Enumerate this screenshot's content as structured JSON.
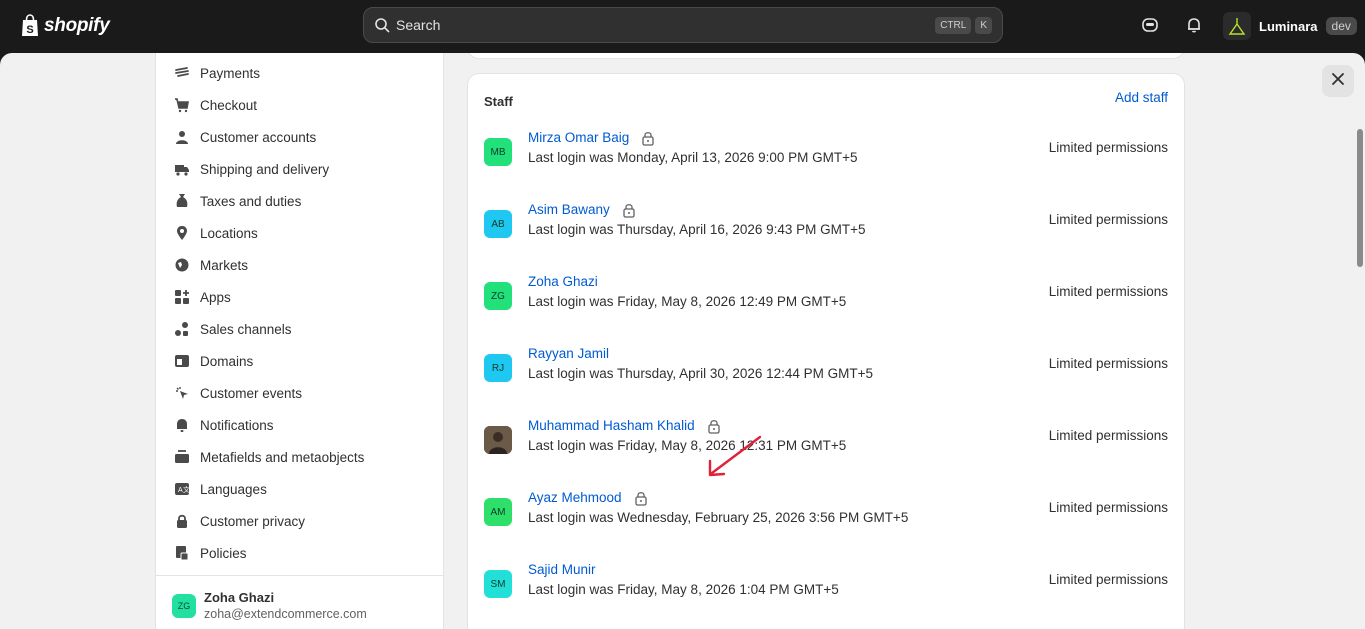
{
  "topbar": {
    "logo_text": "shopify",
    "search_placeholder": "Search",
    "kbd_ctrl": "CTRL",
    "kbd_k": "K",
    "store_name": "Luminara",
    "store_badge": "dev"
  },
  "sidebar": {
    "items": [
      {
        "label": "Payments",
        "icon": "payments-icon"
      },
      {
        "label": "Checkout",
        "icon": "cart-icon"
      },
      {
        "label": "Customer accounts",
        "icon": "person-icon"
      },
      {
        "label": "Shipping and delivery",
        "icon": "truck-icon"
      },
      {
        "label": "Taxes and duties",
        "icon": "tax-icon"
      },
      {
        "label": "Locations",
        "icon": "location-icon"
      },
      {
        "label": "Markets",
        "icon": "globe-icon"
      },
      {
        "label": "Apps",
        "icon": "apps-icon"
      },
      {
        "label": "Sales channels",
        "icon": "channels-icon"
      },
      {
        "label": "Domains",
        "icon": "domain-icon"
      },
      {
        "label": "Customer events",
        "icon": "cursor-icon"
      },
      {
        "label": "Notifications",
        "icon": "bell-icon"
      },
      {
        "label": "Metafields and metaobjects",
        "icon": "metafields-icon"
      },
      {
        "label": "Languages",
        "icon": "language-icon"
      },
      {
        "label": "Customer privacy",
        "icon": "lock-icon"
      },
      {
        "label": "Policies",
        "icon": "policy-icon"
      }
    ],
    "user": {
      "initials": "ZG",
      "name": "Zoha Ghazi",
      "email": "zoha@extendcommerce.com"
    }
  },
  "staff": {
    "title": "Staff",
    "add_label": "Add staff",
    "members": [
      {
        "initials": "MB",
        "name": "Mirza Omar Baig",
        "login": "Last login was Monday, April 13, 2026 9:00 PM GMT+5",
        "permission": "Limited permissions",
        "avatar_color": "#22e07a",
        "locked": true
      },
      {
        "initials": "AB",
        "name": "Asim Bawany",
        "login": "Last login was Thursday, April 16, 2026 9:43 PM GMT+5",
        "permission": "Limited permissions",
        "avatar_color": "#1fc8f0",
        "locked": true
      },
      {
        "initials": "ZG",
        "name": "Zoha Ghazi",
        "login": "Last login was Friday, May 8, 2026 12:49 PM GMT+5",
        "permission": "Limited permissions",
        "avatar_color": "#22e07a",
        "locked": false
      },
      {
        "initials": "RJ",
        "name": "Rayyan Jamil",
        "login": "Last login was Thursday, April 30, 2026 12:44 PM GMT+5",
        "permission": "Limited permissions",
        "avatar_color": "#1fc8f0",
        "locked": false
      },
      {
        "initials": "",
        "name": "Muhammad Hasham Khalid",
        "login": "Last login was Friday, May 8, 2026 12:31 PM GMT+5",
        "permission": "Limited permissions",
        "avatar_color": "#5a4e42",
        "locked": true
      },
      {
        "initials": "AM",
        "name": "Ayaz Mehmood",
        "login": "Last login was Wednesday, February 25, 2026 3:56 PM GMT+5",
        "permission": "Limited permissions",
        "avatar_color": "#2ee06a",
        "locked": true
      },
      {
        "initials": "SM",
        "name": "Sajid Munir",
        "login": "Last login was Friday, May 8, 2026 1:04 PM GMT+5",
        "permission": "Limited permissions",
        "avatar_color": "#22e0d8",
        "locked": false
      }
    ]
  },
  "colors": {
    "link": "#005bd3",
    "annotation_arrow": "#e0213a"
  }
}
